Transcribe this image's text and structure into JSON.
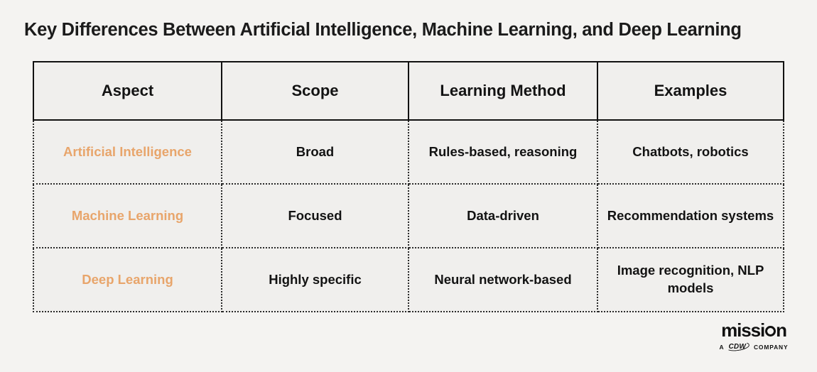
{
  "page": {
    "title": "Key Differences Between Artificial Intelligence, Machine Learning, and Deep Learning",
    "background_color": "#f4f3f1",
    "accent_color": "#e8a56b",
    "text_color": "#131313"
  },
  "table": {
    "headers": [
      "Aspect",
      "Scope",
      "Learning Method",
      "Examples"
    ],
    "rows": [
      {
        "aspect": "Artificial Intelligence",
        "scope": "Broad",
        "learning_method": "Rules-based, reasoning",
        "examples": "Chatbots, robotics"
      },
      {
        "aspect": "Machine Learning",
        "scope": "Focused",
        "learning_method": "Data-driven",
        "examples": "Recommendation systems"
      },
      {
        "aspect": "Deep Learning",
        "scope": "Highly specific",
        "learning_method": "Neural network-based",
        "examples": "Image recognition, NLP models"
      }
    ]
  },
  "logo": {
    "wordmark_part1": "missi",
    "wordmark_part2": "n",
    "tagline_prefix": "A",
    "tagline_brand": "CDW",
    "tagline_suffix": "COMPANY"
  }
}
